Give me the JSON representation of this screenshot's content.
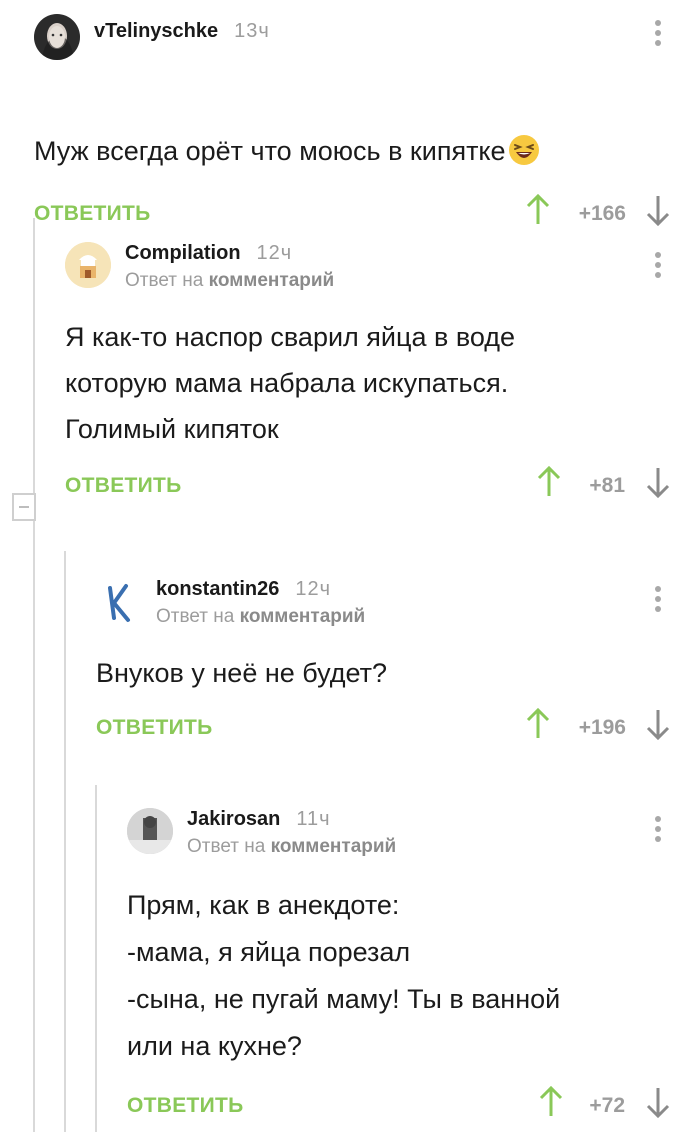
{
  "comments": [
    {
      "author": "vTelinyschke",
      "time": "13ч",
      "reply_prefix": "",
      "reply_target": "",
      "text": "Муж всегда орёт что моюсь в кипятке",
      "emoji": "laughing-emoji",
      "reply_label": "ОТВЕТИТЬ",
      "score": "+166"
    },
    {
      "author": "Compilation",
      "time": "12ч",
      "reply_prefix": "Ответ на",
      "reply_target": "комментарий",
      "text": "Я как-то наспор сварил яйца в воде\nкоторую мама набрала искупаться.\nГолимый кипяток",
      "reply_label": "ОТВЕТИТЬ",
      "score": "+81"
    },
    {
      "author": "konstantin26",
      "time": "12ч",
      "reply_prefix": "Ответ на",
      "reply_target": "комментарий",
      "text": "Внуков у неё не будет?",
      "reply_label": "ОТВЕТИТЬ",
      "score": "+196"
    },
    {
      "author": "Jakirosan",
      "time": "11ч",
      "reply_prefix": "Ответ на",
      "reply_target": "комментарий",
      "text": "Прям, как в анекдоте:\n-мама, я яйца порезал\n-сына, не пугай маму! Ты в ванной\nили на кухне?",
      "reply_label": "ОТВЕТИТЬ",
      "score": "+72"
    }
  ],
  "colors": {
    "accent_green": "#8ac858",
    "muted_gray": "#9c9c9c",
    "thread_line": "#d9d9d9"
  },
  "icons": [
    "avatar",
    "kebab-menu-icon",
    "arrow-up-icon",
    "arrow-down-icon",
    "collapse-thread-icon",
    "laughing-emoji"
  ]
}
